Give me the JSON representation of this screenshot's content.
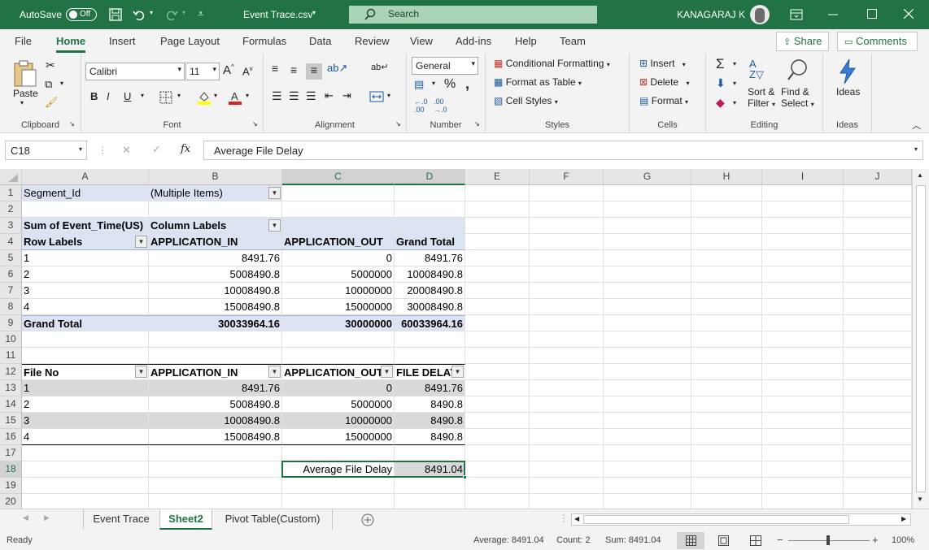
{
  "titlebar": {
    "autosave_label": "AutoSave",
    "autosave_state": "Off",
    "filename": "Event Trace.csv",
    "search_placeholder": "Search",
    "user": "KANAGARAJ K"
  },
  "menu": {
    "tabs": [
      "File",
      "Home",
      "Insert",
      "Page Layout",
      "Formulas",
      "Data",
      "Review",
      "View",
      "Add-ins",
      "Help",
      "Team"
    ],
    "active_tab": "Home",
    "share": "Share",
    "comments": "Comments"
  },
  "ribbon": {
    "clipboard": {
      "paste": "Paste",
      "label": "Clipboard"
    },
    "font": {
      "name": "Calibri",
      "size": "11",
      "bold": "B",
      "italic": "I",
      "underline": "U",
      "label": "Font"
    },
    "alignment": {
      "label": "Alignment"
    },
    "number": {
      "format": "General",
      "label": "Number"
    },
    "styles": {
      "conditional": "Conditional Formatting",
      "format_table": "Format as Table",
      "cell_styles": "Cell Styles",
      "label": "Styles"
    },
    "cells": {
      "insert": "Insert",
      "delete": "Delete",
      "format": "Format",
      "label": "Cells"
    },
    "editing": {
      "sort": "Sort &",
      "filter": "Filter",
      "find": "Find &",
      "select": "Select",
      "label": "Editing"
    },
    "ideas": {
      "button": "Ideas",
      "label": "Ideas"
    }
  },
  "formula_bar": {
    "name_box": "C18",
    "content": "Average File Delay"
  },
  "columns": [
    "A",
    "B",
    "C",
    "D",
    "E",
    "F",
    "G",
    "H",
    "I",
    "J"
  ],
  "rows": [
    "1",
    "2",
    "3",
    "4",
    "5",
    "6",
    "7",
    "8",
    "9",
    "10",
    "11",
    "12",
    "13",
    "14",
    "15",
    "16",
    "17",
    "18",
    "19",
    "20"
  ],
  "cells": {
    "A1": "Segment_Id",
    "B1": "(Multiple Items)",
    "A3": "Sum of Event_Time(US)",
    "B3": "Column Labels",
    "A4": "Row Labels",
    "B4": "APPLICATION_IN",
    "C4": "APPLICATION_OUT",
    "D4": "Grand Total",
    "A5": "1",
    "B5": "8491.76",
    "C5": "0",
    "D5": "8491.76",
    "A6": "2",
    "B6": "5008490.8",
    "C6": "5000000",
    "D6": "10008490.8",
    "A7": "3",
    "B7": "10008490.8",
    "C7": "10000000",
    "D7": "20008490.8",
    "A8": "4",
    "B8": "15008490.8",
    "C8": "15000000",
    "D8": "30008490.8",
    "A9": "Grand Total",
    "B9": "30033964.16",
    "C9": "30000000",
    "D9": "60033964.16",
    "A12": "File No",
    "B12": "APPLICATION_IN",
    "C12": "APPLICATION_OUT",
    "D12": "FILE DELAY",
    "A13": "1",
    "B13": "8491.76",
    "C13": "0",
    "D13": "8491.76",
    "A14": "2",
    "B14": "5008490.8",
    "C14": "5000000",
    "D14": "8490.8",
    "A15": "3",
    "B15": "10008490.8",
    "C15": "10000000",
    "D15": "8490.8",
    "A16": "4",
    "B16": "15008490.8",
    "C16": "15000000",
    "D16": "8490.8",
    "C18": "Average File Delay",
    "D18": "8491.04"
  },
  "sheets": [
    "Event Trace",
    "Sheet2",
    "Pivot Table(Custom)"
  ],
  "active_sheet": "Sheet2",
  "status": {
    "mode": "Ready",
    "average": "Average: 8491.04",
    "count": "Count: 2",
    "sum": "Sum: 8491.04",
    "zoom": "100%"
  },
  "colors": {
    "brand": "#217346",
    "pivot_header": "#dce3f3",
    "band": "#d9d9d9"
  }
}
